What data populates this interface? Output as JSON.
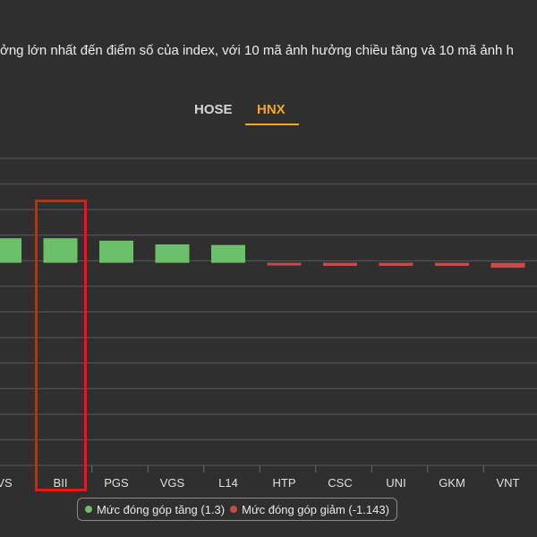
{
  "description": "ởng lớn nhất đến điểm số của index, với 10 mã ảnh hưởng chiều tăng và 10 mã ảnh h",
  "tabs": [
    {
      "label": "HOSE",
      "active": false
    },
    {
      "label": "HNX",
      "active": true
    }
  ],
  "colors": {
    "positive": "#6cc06a",
    "negative": "#c94a4a",
    "accent": "#f5a623",
    "highlight": "#e01b1b"
  },
  "legend": {
    "positive_label": "Mức đóng góp tăng (1.3)",
    "negative_label": "Mức đóng góp giảm (-1.143)"
  },
  "chart_data": {
    "type": "bar",
    "categories": [
      "VS",
      "BII",
      "PGS",
      "VGS",
      "L14",
      "HTP",
      "CSC",
      "UNI",
      "GKM",
      "VNT"
    ],
    "series": [
      {
        "name": "Mức đóng góp tăng (1.3)",
        "values": [
          0.2,
          0.2,
          0.18,
          0.15,
          0.145,
          null,
          null,
          null,
          null,
          null
        ]
      },
      {
        "name": "Mức đóng góp giảm (-1.143)",
        "values": [
          null,
          null,
          null,
          null,
          null,
          -0.02,
          -0.025,
          -0.025,
          -0.025,
          -0.04
        ]
      }
    ],
    "ylim": [
      -1.65,
      0.85
    ],
    "grid": true,
    "highlighted_category": "BII",
    "legend_position": "bottom"
  }
}
